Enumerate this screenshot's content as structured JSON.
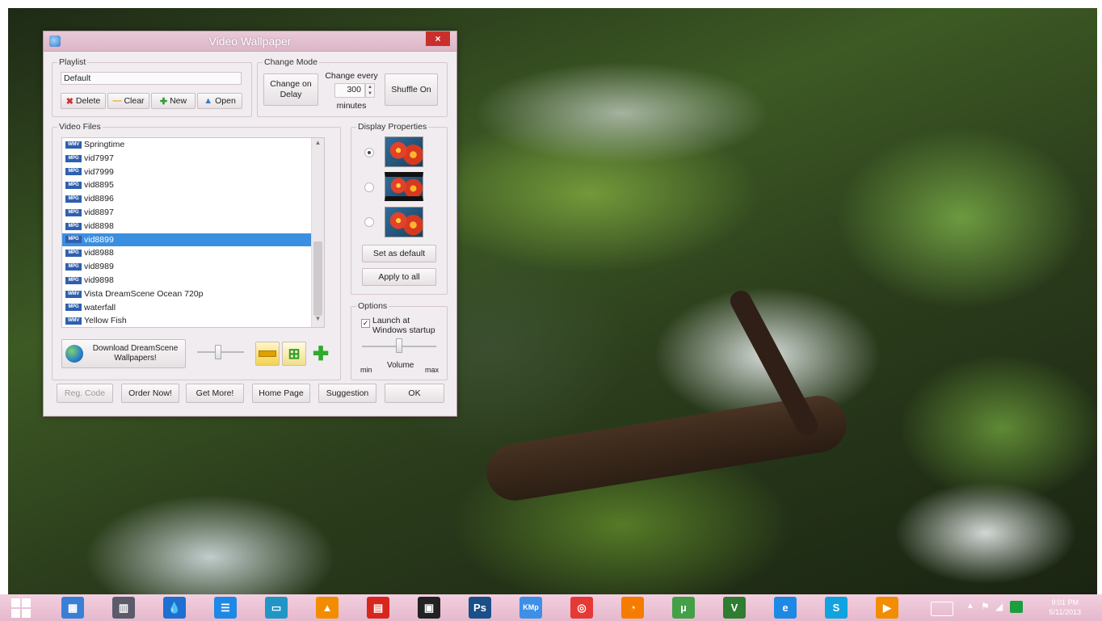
{
  "window": {
    "title": "Video Wallpaper",
    "close_label": "×"
  },
  "playlist": {
    "group_label": "Playlist",
    "value": "Default",
    "buttons": {
      "delete": "Delete",
      "clear": "Clear",
      "new": "New",
      "open": "Open"
    }
  },
  "change_mode": {
    "group_label": "Change Mode",
    "change_on_delay": "Change on Delay",
    "change_every_label": "Change every",
    "change_every_value": "300",
    "minutes_label": "minutes",
    "shuffle_button": "Shuffle On"
  },
  "video_files": {
    "group_label": "Video Files",
    "items": [
      {
        "type": "WMV",
        "name": "Springtime"
      },
      {
        "type": "MPG",
        "name": "vid7997"
      },
      {
        "type": "MPG",
        "name": "vid7999"
      },
      {
        "type": "MPG",
        "name": "vid8895"
      },
      {
        "type": "MPG",
        "name": "vid8896"
      },
      {
        "type": "MPG",
        "name": "vid8897"
      },
      {
        "type": "MPG",
        "name": "vid8898"
      },
      {
        "type": "MPG",
        "name": "vid8899"
      },
      {
        "type": "MPG",
        "name": "vid8988"
      },
      {
        "type": "MPG",
        "name": "vid8989"
      },
      {
        "type": "MPG",
        "name": "vid9898"
      },
      {
        "type": "WMV",
        "name": "Vista DreamScene Ocean 720p"
      },
      {
        "type": "MPG",
        "name": "waterfall"
      },
      {
        "type": "WMV",
        "name": "Yellow Fish"
      }
    ],
    "selected_index": 7,
    "download_button": "Download DreamScene Wallpapers!",
    "slider_level": 0.45
  },
  "display_properties": {
    "group_label": "Display Properties",
    "selected_option": 0,
    "set_default_button": "Set as default",
    "apply_all_button": "Apply to all"
  },
  "options": {
    "group_label": "Options",
    "launch_label": "Launch at Windows startup",
    "launch_checked": true,
    "volume_label": "Volume",
    "min_label": "min",
    "max_label": "max",
    "volume_level": 0.5
  },
  "footer": {
    "reg_code": "Reg. Code",
    "order_now": "Order Now!",
    "get_more": "Get More!",
    "home_page": "Home Page",
    "suggestion": "Suggestion",
    "ok": "OK"
  },
  "taskbar": {
    "icons": [
      {
        "name": "task-manager-icon",
        "color": "#3a7fd6",
        "glyph": "▦"
      },
      {
        "name": "media-library-icon",
        "color": "#5b5b6b",
        "glyph": "▥"
      },
      {
        "name": "water-drop-icon",
        "color": "#1d6fd1",
        "glyph": "💧"
      },
      {
        "name": "outlook-icon",
        "color": "#1e88e5",
        "glyph": "☰"
      },
      {
        "name": "file-explorer-icon",
        "color": "#2196c6",
        "glyph": "▭"
      },
      {
        "name": "vlc-icon",
        "color": "#f28c00",
        "glyph": "▲"
      },
      {
        "name": "presentation-icon",
        "color": "#d7261e",
        "glyph": "▤"
      },
      {
        "name": "video-editor-icon",
        "color": "#222222",
        "glyph": "▣"
      },
      {
        "name": "photoshop-icon",
        "color": "#1b4f8a",
        "glyph": "Ps"
      },
      {
        "name": "kmplayer-icon",
        "color": "#3d8fe8",
        "glyph": "KMp"
      },
      {
        "name": "chrome-icon",
        "color": "#e53935",
        "glyph": "◎"
      },
      {
        "name": "firefox-icon",
        "color": "#f57c00",
        "glyph": "◔"
      },
      {
        "name": "utorrent-icon",
        "color": "#43a047",
        "glyph": "µ"
      },
      {
        "name": "vuze-icon",
        "color": "#2e7d32",
        "glyph": "V"
      },
      {
        "name": "internet-explorer-icon",
        "color": "#1e88e5",
        "glyph": "e"
      },
      {
        "name": "skype-icon",
        "color": "#0fa3e0",
        "glyph": "S"
      },
      {
        "name": "media-center-icon",
        "color": "#f28c00",
        "glyph": "▶"
      }
    ],
    "clock_time": "9:01 PM",
    "clock_date": "5/11/2013"
  },
  "colors": {
    "accent_selection": "#3b8fe0",
    "title_bar": "#e2bfd0",
    "close_button": "#c9302c",
    "taskbar": "#eec5d8"
  }
}
